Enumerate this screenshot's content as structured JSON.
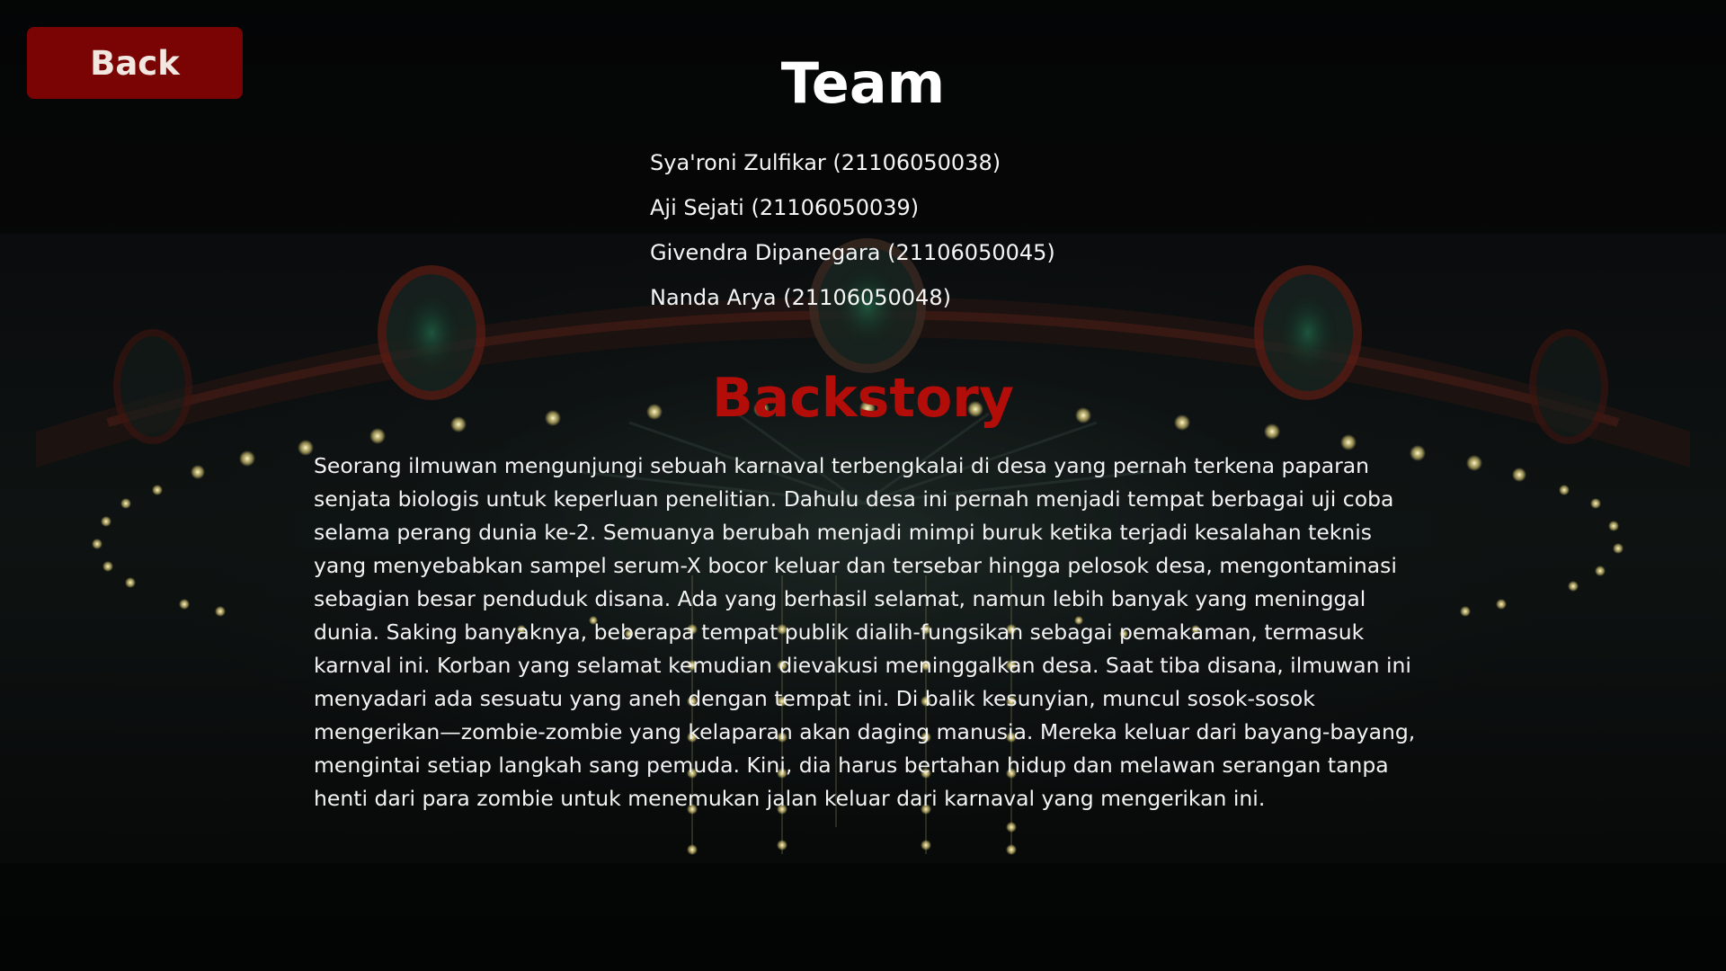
{
  "back_button": {
    "label": "Back"
  },
  "team": {
    "title": "Team",
    "members": [
      "Sya'roni Zulfikar (21106050038)",
      "Aji Sejati (21106050039)",
      "Givendra Dipanegara (21106050045)",
      "Nanda Arya (21106050048)"
    ]
  },
  "backstory": {
    "title": "Backstory",
    "text": "Seorang ilmuwan mengunjungi sebuah karnaval terbengkalai di desa yang pernah terkena paparan senjata biologis untuk keperluan penelitian. Dahulu desa ini pernah menjadi tempat berbagai uji coba selama perang dunia ke-2. Semuanya berubah menjadi mimpi buruk ketika terjadi kesalahan teknis yang menyebabkan sampel serum-X bocor keluar dan tersebar hingga pelosok desa, mengontaminasi sebagian besar penduduk disana. Ada yang berhasil selamat, namun lebih banyak yang meninggal dunia. Saking banyaknya, beberapa tempat publik dialih-fungsikan sebagai pemakaman, termasuk karnval ini. Korban yang selamat kemudian dievakusi meninggalkan desa. Saat tiba disana, ilmuwan ini menyadari ada sesuatu yang aneh dengan tempat ini. Di balik kesunyian, muncul sosok-sosok mengerikan—zombie-zombie yang kelaparan akan daging manusia. Mereka keluar dari bayang-bayang, mengintai setiap langkah sang pemuda. Kini, dia harus bertahan hidup dan melawan serangan tanpa henti dari para zombie untuk menemukan jalan keluar dari karnaval yang mengerikan ini."
  },
  "colors": {
    "background": "#050607",
    "back_button": "#7a0403",
    "backstory_title": "#b30d0a",
    "text": "#f3f3f3"
  }
}
